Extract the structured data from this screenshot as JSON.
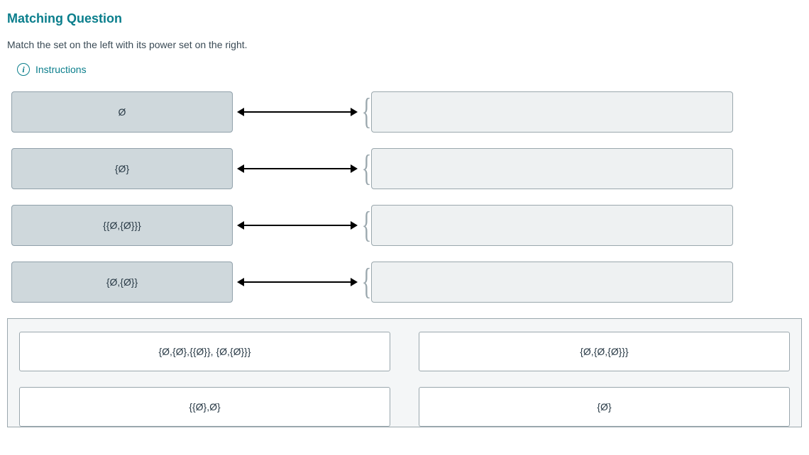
{
  "title": "Matching Question",
  "prompt": "Match the set on the left with its power set on the right.",
  "instructions_label": "Instructions",
  "left_items": [
    {
      "label": "Ø"
    },
    {
      "label": "{Ø}"
    },
    {
      "label": "{{Ø,{Ø}}}"
    },
    {
      "label": "{Ø,{Ø}}"
    }
  ],
  "answers": [
    {
      "label": "{Ø,{Ø},{{Ø}}, {Ø,{Ø}}}"
    },
    {
      "label": "{Ø,{Ø,{Ø}}}"
    },
    {
      "label": "{{Ø},Ø}"
    },
    {
      "label": "{Ø}"
    }
  ]
}
